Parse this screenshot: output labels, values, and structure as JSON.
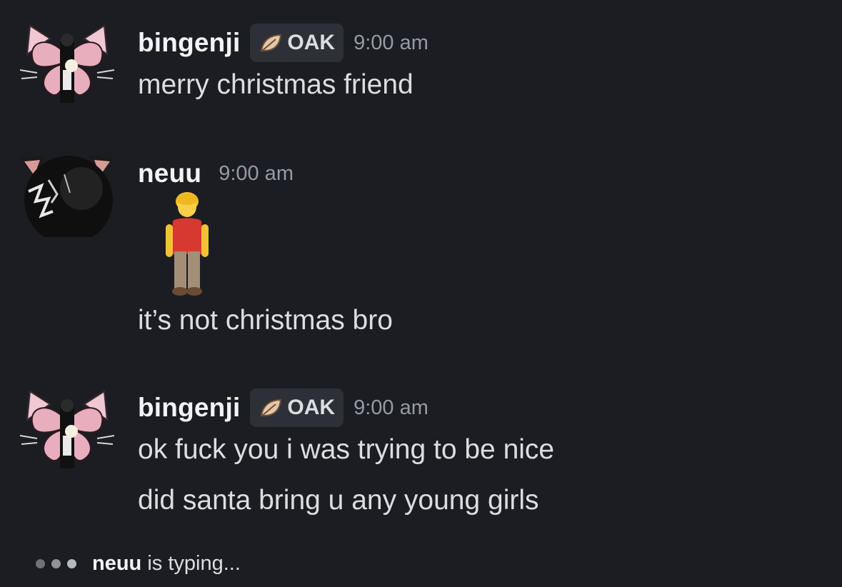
{
  "messages": [
    {
      "username": "bingenji",
      "badge": "OAK",
      "time": "9:00 am",
      "lines": [
        "merry christmas friend"
      ],
      "avatar_icon": "butterfly-cat-avatar"
    },
    {
      "username": "neuu",
      "time": "9:00 am",
      "emoji": "man-standing-emoji",
      "lines": [
        "it’s not christmas bro"
      ],
      "avatar_icon": "dark-cat-avatar"
    },
    {
      "username": "bingenji",
      "badge": "OAK",
      "time": "9:00 am",
      "lines": [
        "ok fuck you i was trying to be nice",
        "did santa bring u any young girls"
      ],
      "avatar_icon": "butterfly-cat-avatar"
    }
  ],
  "typing": {
    "user": "neuu",
    "suffix": " is typing..."
  },
  "colors": {
    "background": "#1c1d22",
    "username": "#f2f3f5",
    "timestamp": "#949ba4",
    "badge_bg": "#2e3037"
  }
}
